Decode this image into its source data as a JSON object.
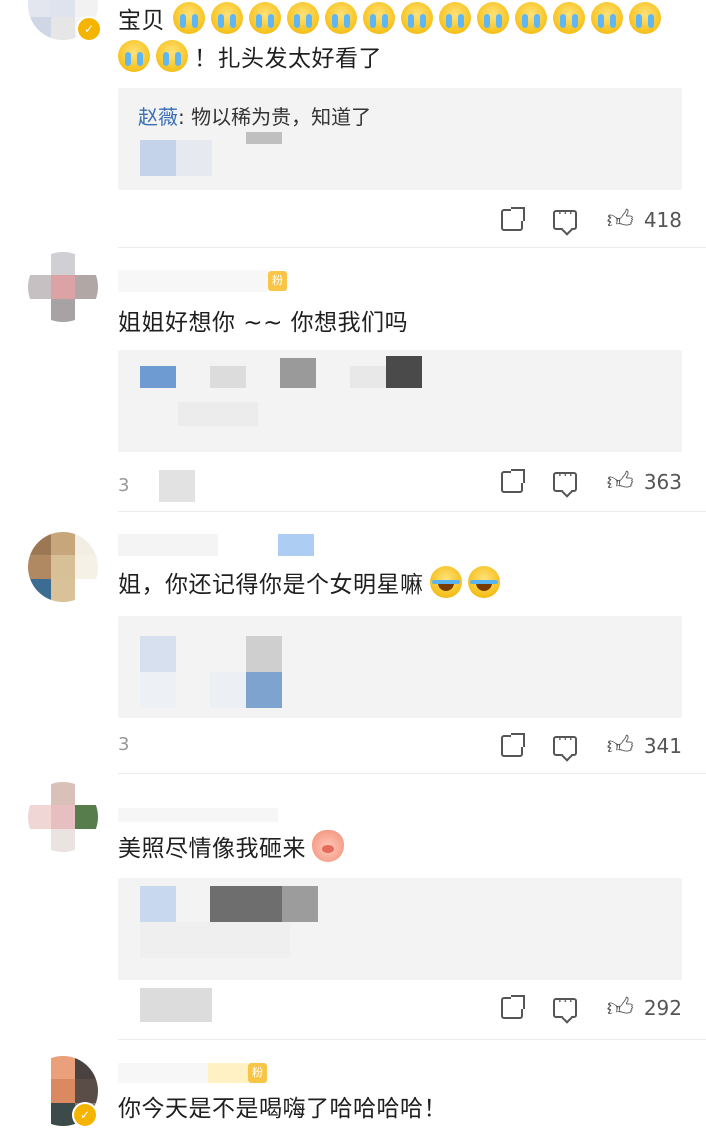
{
  "comments": [
    {
      "text_prefix": "宝贝",
      "text_suffix": "！扎头发太好看了",
      "cry_emoji_count": 15,
      "reply": {
        "user": "赵薇",
        "text": ": 物以稀为贵，知道了"
      },
      "likes": "418"
    },
    {
      "text": "姐姐好想你 ~~ 你想我们吗",
      "fans_badge": "粉",
      "time_partial": "3",
      "likes": "363"
    },
    {
      "text": "姐，你还记得你是个女明星嘛",
      "time_partial": "3",
      "likes": "341"
    },
    {
      "text": "美照尽情像我砸来",
      "likes": "292"
    },
    {
      "text": "你今天是不是喝嗨了哈哈哈哈！",
      "fans_badge": "粉"
    }
  ],
  "icons": {
    "share": "share-icon",
    "comment": "comment-icon",
    "like": "thumbs-up-icon",
    "verified": "verified-badge-icon"
  },
  "colors": {
    "reply_user": "#3a6fb6",
    "reply_bg": "#f3f3f3",
    "badge": "#f5b400",
    "icon": "#555555"
  }
}
